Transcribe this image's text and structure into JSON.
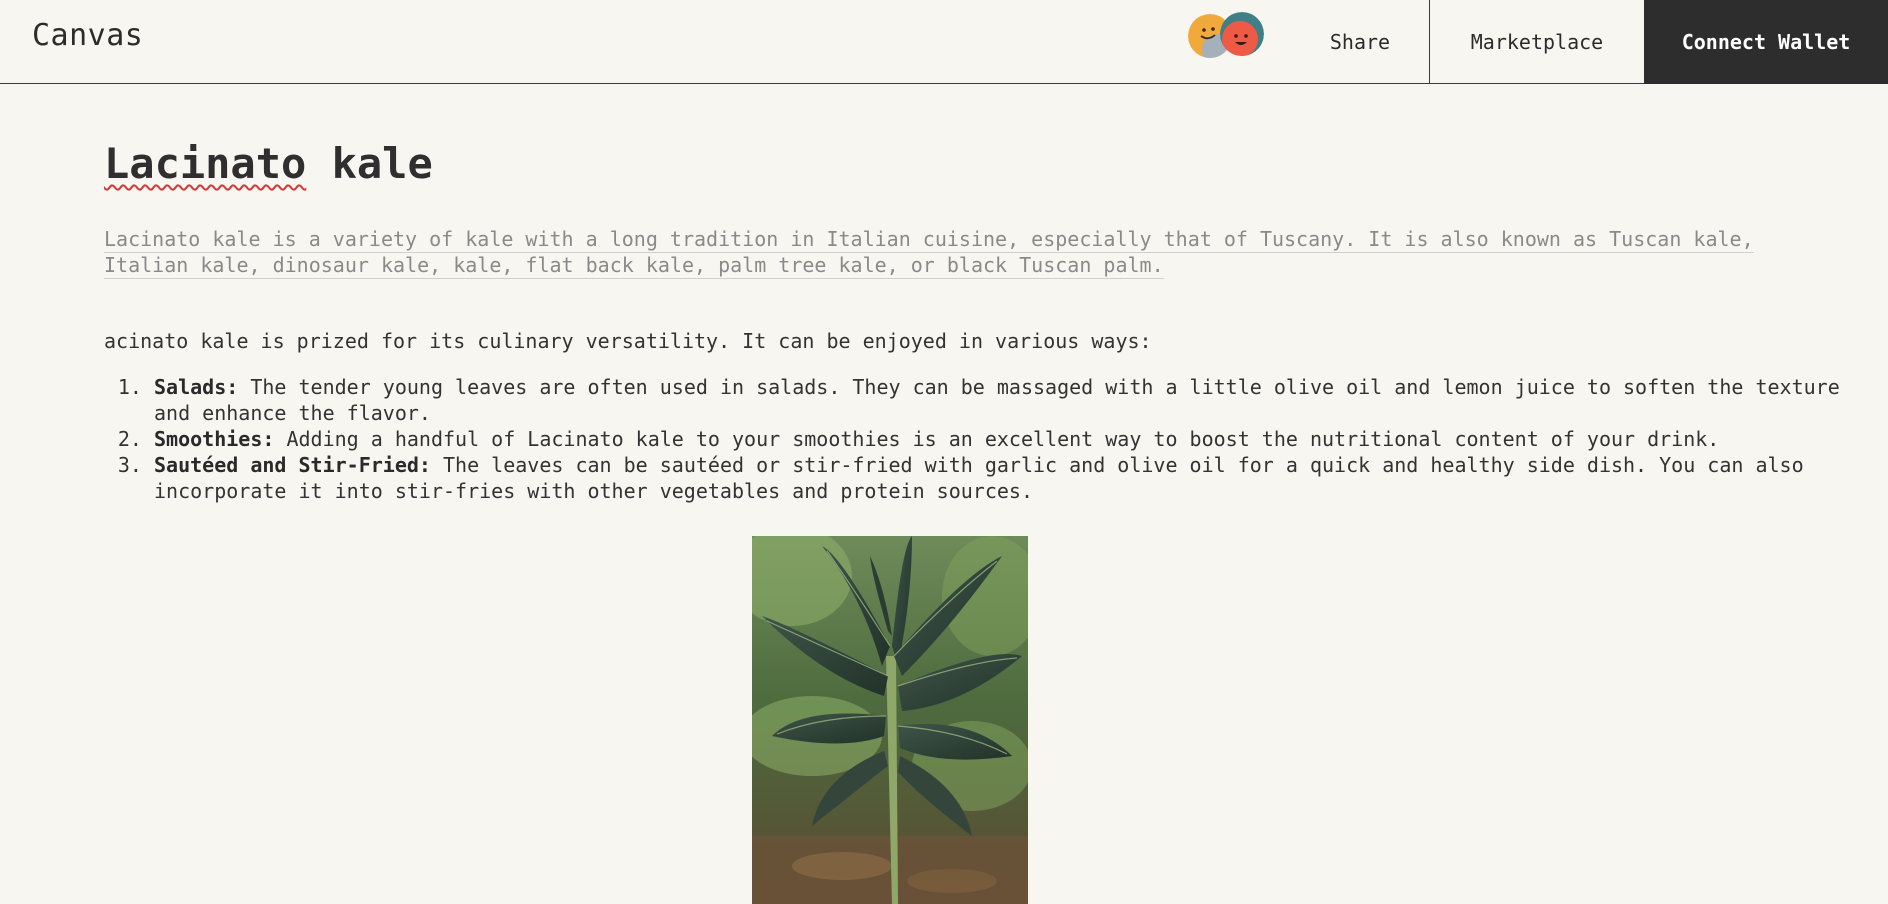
{
  "header": {
    "brand": "Canvas",
    "share_label": "Share",
    "marketplace_label": "Marketplace",
    "connect_wallet_label": "Connect Wallet",
    "avatars": [
      "smiley-avatar-yellow",
      "smiley-avatar-red"
    ]
  },
  "article": {
    "title_word_1": "Lacinato",
    "title_word_2": "kale",
    "lead_line_1": "Lacinato kale is a variety of kale with a long tradition in Italian cuisine, especially that of Tuscany. It is also known as Tuscan kale,",
    "lead_line_2": "Italian kale, dinosaur kale, kale, flat back kale, palm tree kale, or black Tuscan palm.",
    "intro": "acinato kale is prized for its culinary versatility. It can be enjoyed in various ways:",
    "uses": [
      {
        "label": "Salads:",
        "text": "The tender young leaves are often used in salads. They can be massaged with a little olive oil and lemon juice to soften the texture and enhance the flavor."
      },
      {
        "label": "Smoothies:",
        "text": "Adding a handful of Lacinato kale to your smoothies is an excellent way to boost the nutritional content of your drink."
      },
      {
        "label": "Sautéed and Stir-Fried:",
        "text": "The leaves can be sautéed or stir-fried with garlic and olive oil for a quick and healthy side dish. You can also incorporate it into stir-fries with other vegetables and protein sources."
      }
    ],
    "image_subject": "lacinato-kale-plant-photo"
  },
  "colors": {
    "background": "#f7f6f1",
    "connect_wallet_bg": "#2d2d2d",
    "avatar_yellow": "#f2a93b",
    "avatar_red": "#ee5a45",
    "avatar_teal": "#3f7f86",
    "spellcheck_underline": "#d23a3a"
  }
}
